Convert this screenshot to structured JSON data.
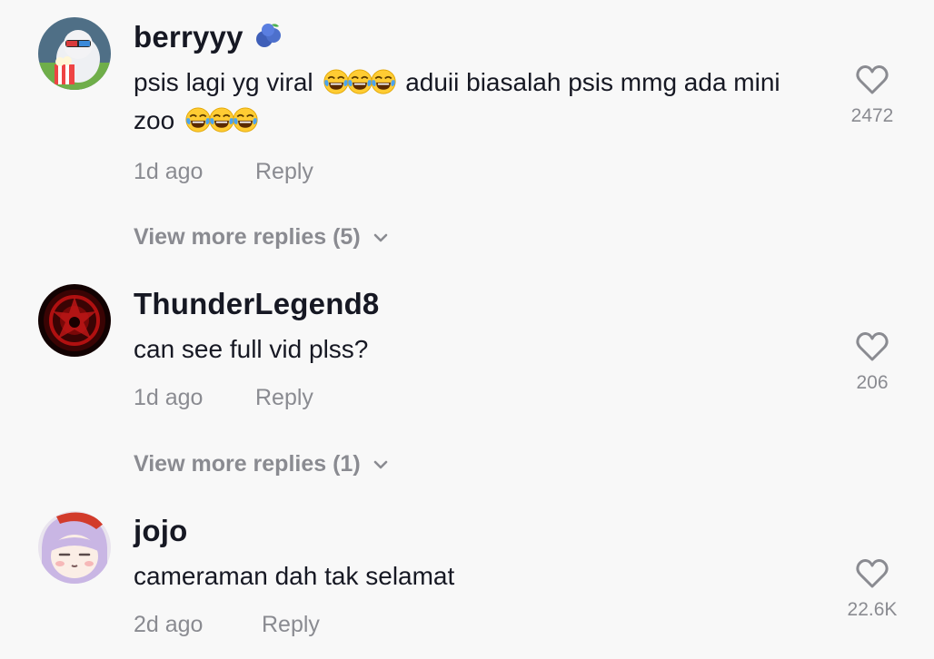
{
  "comments": [
    {
      "username": "berryyy",
      "badge_icon": "blueberry-emoji-icon",
      "text_part1": "psis lagi yg viral",
      "emoji_group1": "face-with-tears-of-joy-icon x3",
      "text_part2": "aduii biasalah psis mmg ada mini zoo",
      "emoji_group2": "face-with-tears-of-joy-icon x3",
      "time": "1d ago",
      "reply_label": "Reply",
      "likes": "2472",
      "view_more": "View more replies (5)"
    },
    {
      "username": "ThunderLegend8",
      "text": "can see full vid plss?",
      "time": "1d ago",
      "reply_label": "Reply",
      "likes": "206",
      "view_more": "View more replies (1)"
    },
    {
      "username": "jojo",
      "text": "cameraman dah tak selamat",
      "time": "2d ago",
      "reply_label": "Reply",
      "likes": "22.6K"
    }
  ],
  "colors": {
    "background": "#f8f8f8",
    "primary_text": "#161823",
    "secondary_text": "#8a8b91"
  }
}
